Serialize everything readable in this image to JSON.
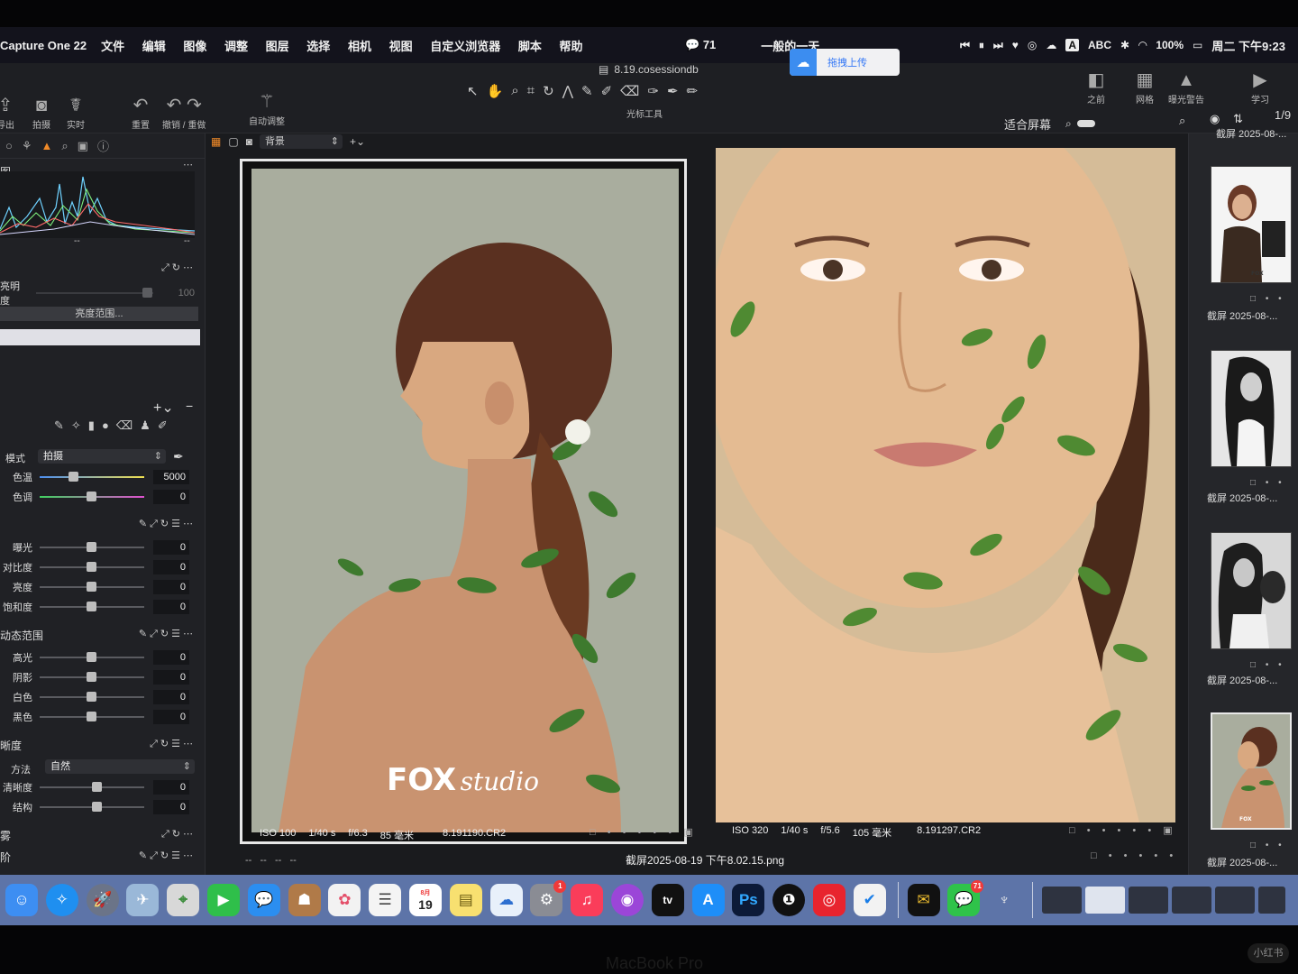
{
  "menubar": {
    "app_name": "Capture One 22",
    "menus": [
      "文件",
      "编辑",
      "图像",
      "调整",
      "图层",
      "选择",
      "相机",
      "视图",
      "自定义浏览器",
      "脚本",
      "帮助"
    ],
    "wechat_count": "71",
    "focus_mode": "一般的一天",
    "input_source": "ABC",
    "battery": "100%",
    "clock": "周二 下午9:23"
  },
  "upload_widget": {
    "label": "拖拽上传"
  },
  "toolbar": {
    "doc_title": "8.19.cosessiondb",
    "export_label": "导出",
    "capture_label": "拍摄",
    "live_label": "实时",
    "reset_label": "重置",
    "undo_redo_label": "撤销 / 重做",
    "auto_adjust_label": "自动调整",
    "cursor_tools_label": "光标工具",
    "before_label": "之前",
    "grid_label": "网格",
    "exposure_warning_label": "曝光警告",
    "learn_label": "学习",
    "fit_screen_label": "适合屏幕",
    "image_counter": "1/9"
  },
  "left_panel": {
    "histogram_title": "图",
    "histogram_left": "--",
    "histogram_right": "--",
    "brightness_label": "亮明度",
    "brightness_value": "100",
    "brightness_range_button": "亮度范围...",
    "white_balance": {
      "mode_label": "模式",
      "mode_value": "拍摄",
      "temp_label": "色温",
      "temp_value": "5000",
      "tint_label": "色调",
      "tint_value": "0"
    },
    "exposure": [
      {
        "label": "曝光",
        "value": "0"
      },
      {
        "label": "对比度",
        "value": "0"
      },
      {
        "label": "亮度",
        "value": "0"
      },
      {
        "label": "饱和度",
        "value": "0"
      }
    ],
    "hdr_title": "动态范围",
    "hdr": [
      {
        "label": "高光",
        "value": "0"
      },
      {
        "label": "阴影",
        "value": "0"
      },
      {
        "label": "白色",
        "value": "0"
      },
      {
        "label": "黑色",
        "value": "0"
      }
    ],
    "clarity_title": "晰度",
    "clarity_method_label": "方法",
    "clarity_method_value": "自然",
    "clarity": [
      {
        "label": "清晰度",
        "value": "0"
      },
      {
        "label": "结构",
        "value": "0"
      }
    ],
    "dehaze_title": "雾",
    "levels_title": "阶"
  },
  "viewer": {
    "background_select": "背景",
    "photo_left": {
      "iso": "ISO 100",
      "shutter": "1/40 s",
      "aperture": "f/6.3",
      "focal": "85 毫米",
      "filename": "8.191190.CR2",
      "watermark_bold": "FOX",
      "watermark_script": "studio"
    },
    "photo_right": {
      "iso": "ISO 320",
      "shutter": "1/40 s",
      "aperture": "f/5.6",
      "focal": "105 毫米",
      "filename": "8.191297.CR2"
    },
    "caption": "截屏2025-08-19 下午8.02.15.png",
    "footer_dashes": "--   --   --   --"
  },
  "filmstrip": {
    "top_label": "截屏 2025-08-...",
    "thumbs": [
      {
        "label": "截屏 2025-08-..."
      },
      {
        "label": "截屏 2025-08-..."
      },
      {
        "label": "截屏 2025-08-..."
      },
      {
        "label": "截屏 2025-08-..."
      }
    ]
  },
  "dock": {
    "calendar_month": "8月",
    "calendar_day": "19",
    "settings_badge": "1",
    "wechat_badge": "71",
    "ps_label": "Ps",
    "tv_label": "tv"
  },
  "bezel_label": "MacBook Pro",
  "watermark": "小红书",
  "colors": {
    "accent": "#f08a28",
    "dock": "#5d74a8",
    "panel": "#202125"
  }
}
